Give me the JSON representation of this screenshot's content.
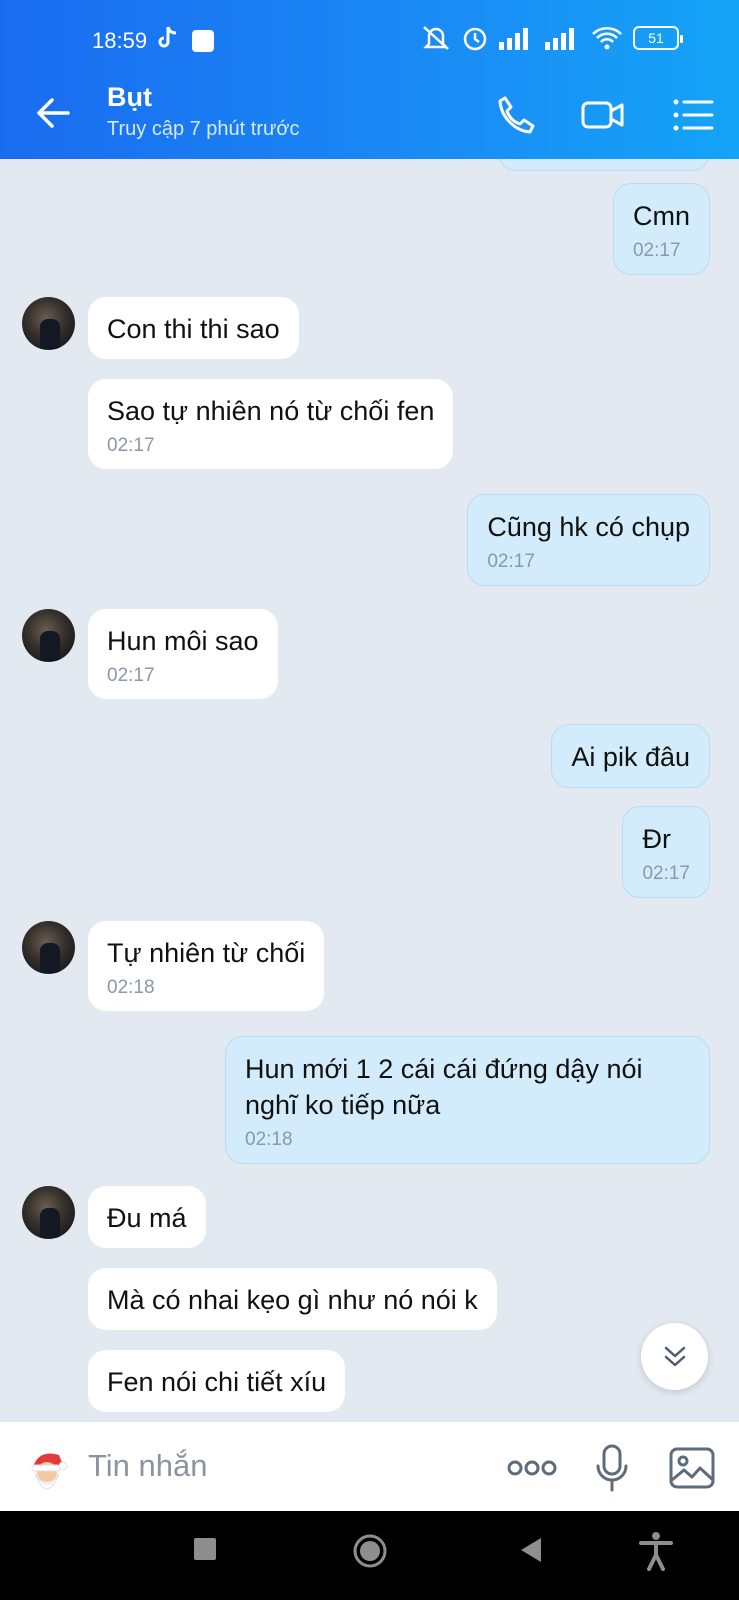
{
  "status": {
    "time": "18:59",
    "battery": "51"
  },
  "header": {
    "name": "Bụt",
    "last_seen": "Truy cập 7 phút trước"
  },
  "messages": [
    {
      "side": "out",
      "text": "Cmn",
      "time": "02:17"
    },
    {
      "side": "in",
      "text": "Con thi thi sao",
      "time": ""
    },
    {
      "side": "in",
      "text": "Sao tự nhiên nó từ chối fen",
      "time": "02:17"
    },
    {
      "side": "out",
      "text": "Cũng hk có chụp",
      "time": "02:17"
    },
    {
      "side": "in",
      "text": "Hun môi sao",
      "time": "02:17"
    },
    {
      "side": "out",
      "text": "Ai pik đâu",
      "time": ""
    },
    {
      "side": "out",
      "text": "Đr",
      "time": "02:17"
    },
    {
      "side": "in",
      "text": "Tự nhiên từ chối",
      "time": "02:18"
    },
    {
      "side": "out",
      "text": "Hun mới 1 2 cái cái đứng dậy nói nghĩ ko tiếp nữa",
      "time": "02:18"
    },
    {
      "side": "in",
      "text": "Đu má",
      "time": ""
    },
    {
      "side": "in",
      "text": "Mà có nhai kẹo gì như nó nói k",
      "time": ""
    },
    {
      "side": "in",
      "text": "Fen nói chi tiết xíu",
      "time": ""
    }
  ],
  "input": {
    "placeholder": "Tin nhắn"
  },
  "icons": {
    "back": "arrow-left-icon",
    "call": "phone-icon",
    "video": "video-call-icon",
    "menu": "list-menu-icon",
    "emoji": "santa-sticker-icon",
    "more": "more-dots-icon",
    "mic": "microphone-icon",
    "image": "image-icon",
    "scroll": "chevron-double-down-icon"
  },
  "colors": {
    "header_start": "#1a6bf0",
    "header_end": "#14a4f7",
    "bubble_out": "#d3ecfc",
    "bubble_in": "#ffffff",
    "chat_bg": "#e2e9f1"
  }
}
